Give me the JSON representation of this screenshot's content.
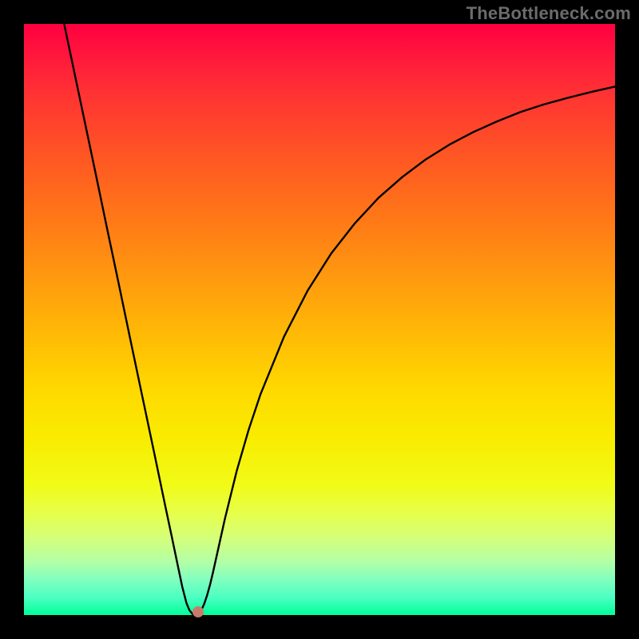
{
  "watermark": "TheBottleneck.com",
  "chart_data": {
    "type": "line",
    "title": "",
    "xlabel": "",
    "ylabel": "",
    "xlim": [
      0,
      100
    ],
    "ylim": [
      0,
      100
    ],
    "grid": false,
    "legend": false,
    "series": [
      {
        "name": "curve",
        "x": [
          6.8,
          8,
          10,
          12,
          14,
          16,
          18,
          20,
          22,
          23,
          24,
          25,
          26,
          26.8,
          27.5,
          28,
          28.5,
          29,
          29.5,
          30,
          30.5,
          31,
          31.5,
          32,
          33,
          34,
          36,
          38,
          40,
          44,
          48,
          52,
          56,
          60,
          64,
          68,
          72,
          76,
          80,
          84,
          88,
          92,
          96,
          100
        ],
        "y": [
          100,
          94.3,
          84.8,
          75.3,
          65.7,
          56.2,
          46.6,
          37.1,
          27.6,
          22.8,
          18.0,
          13.3,
          8.5,
          4.7,
          2.0,
          0.8,
          0.2,
          0.0,
          0.2,
          0.8,
          1.9,
          3.4,
          5.2,
          7.3,
          11.8,
          16.3,
          24.4,
          31.3,
          37.3,
          47.1,
          54.9,
          61.2,
          66.3,
          70.6,
          74.1,
          77.1,
          79.6,
          81.7,
          83.5,
          85.1,
          86.4,
          87.5,
          88.5,
          89.4
        ]
      }
    ],
    "marker": {
      "x": 29.5,
      "y": 0.5
    },
    "gradient_stops": [
      {
        "pct": 0,
        "color": "#ff0040"
      },
      {
        "pct": 50,
        "color": "#ffb806"
      },
      {
        "pct": 70,
        "color": "#f9ec00"
      },
      {
        "pct": 100,
        "color": "#00ff99"
      }
    ]
  }
}
